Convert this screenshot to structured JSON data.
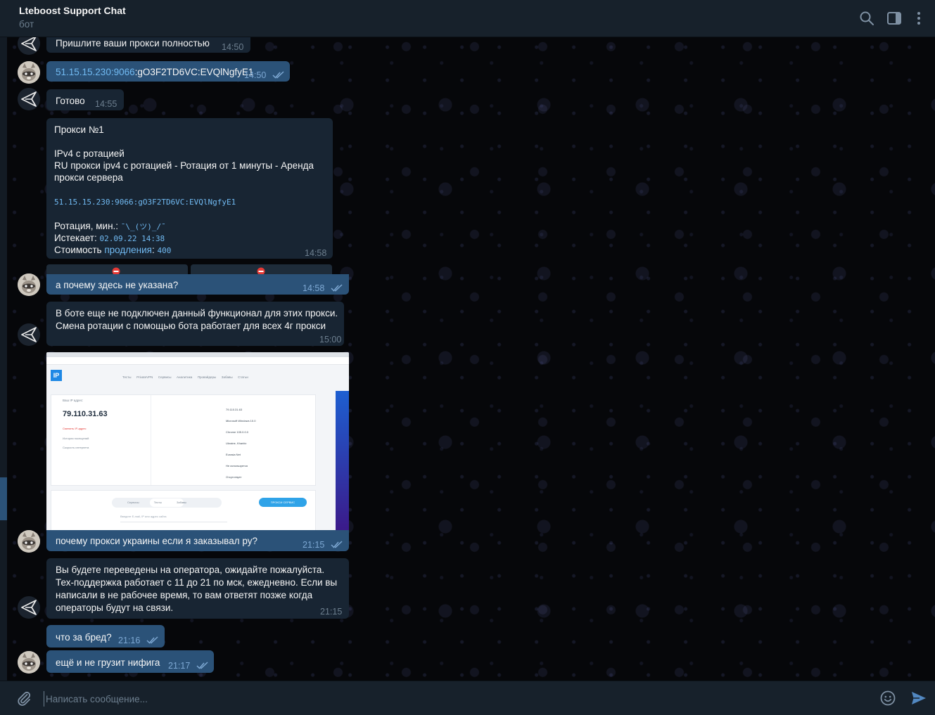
{
  "header": {
    "title": "Lteboost Support Chat",
    "status": "бот",
    "icons": [
      "search-icon",
      "sidebar-toggle-icon",
      "more-icon"
    ]
  },
  "messages": {
    "m1": {
      "text": "Пришлите ваши прокси полностью",
      "time": "14:50"
    },
    "m2": {
      "link": "51.15.15.230:9066",
      "rest": ":gO3F2TD6VC:EVQlNgfyE1",
      "time": "14:50"
    },
    "m3": {
      "text": "Готово",
      "time": "14:55"
    },
    "m4": {
      "title": "Прокси №1",
      "type": "IPv4 с ротацией",
      "description": "RU прокси ipv4 с ротацией - Ротация от 1 минуты - Аренда\nпрокси сервера",
      "proxy": "51.15.15.230:9066:gO3F2TD6VC:EVQlNgfyE1",
      "rotation_label": "Ротация, мин.:",
      "rotation_value": "¯\\_(ツ)_/¯",
      "expires_label": "Истекает:",
      "expires_value": "02.09.22 14:38",
      "cost_label": "Стоимость",
      "cost_link": "продления",
      "cost_value": "400",
      "time": "14:58"
    },
    "m5": {
      "text": "а почему здесь не указана?",
      "time": "14:58"
    },
    "m6": {
      "text": "В боте еще не подключен данный функционал для этих прокси.\nСмена ротации с помощью бота работает для всех 4г прокси",
      "time": "15:00"
    },
    "m7": {
      "text": "почему прокси украины если я заказывал ру?",
      "time": "21:15"
    },
    "m8": {
      "text": "Вы будете переведены на оператора, ожидайте пожалуйста.\nТех-поддержка работает с 11 до 21 по мск, ежедневно. Если вы\nнаписали в не рабочее время, то вам ответят позже когда\nоператоры будут на связи.",
      "time": "21:15"
    },
    "m9": {
      "text": "что за бред?",
      "time": "21:16"
    },
    "m10": {
      "text": "ещё и не грузит нифига",
      "time": "21:17"
    }
  },
  "screenshot": {
    "ip_label": "Ваш IP адрес:",
    "ip": "79.110.31.63",
    "rows": [
      "79.110.31.63",
      "Microsoft Windows 10.0",
      "Chrome 105.0.0.0",
      "Ukraine, Kharkiv",
      "Eurasia Net",
      "Не используется",
      "Отсутствует"
    ],
    "left_links": [
      "Сменить IP-адрес",
      "История посещений",
      "Скорость интернета"
    ],
    "nav": [
      "Тесты",
      "PrivateVPN",
      "Сервисы",
      "Аналитика",
      "Провайдеры",
      "Забавы",
      "Статьи"
    ],
    "tabs": [
      "Сервисы",
      "Тесты",
      "Забавы"
    ],
    "cta": "ПРОКСИ СЕРВИС",
    "search_placeholder": "Введите E-mail, IP или адрес сайта"
  },
  "input": {
    "placeholder": "Написать сообщение..."
  },
  "colors": {
    "header_bg": "#17212b",
    "incoming_bubble": "#182533",
    "outgoing_bubble": "#2b5278",
    "link": "#71baf2",
    "send_icon": "#5288c1"
  }
}
